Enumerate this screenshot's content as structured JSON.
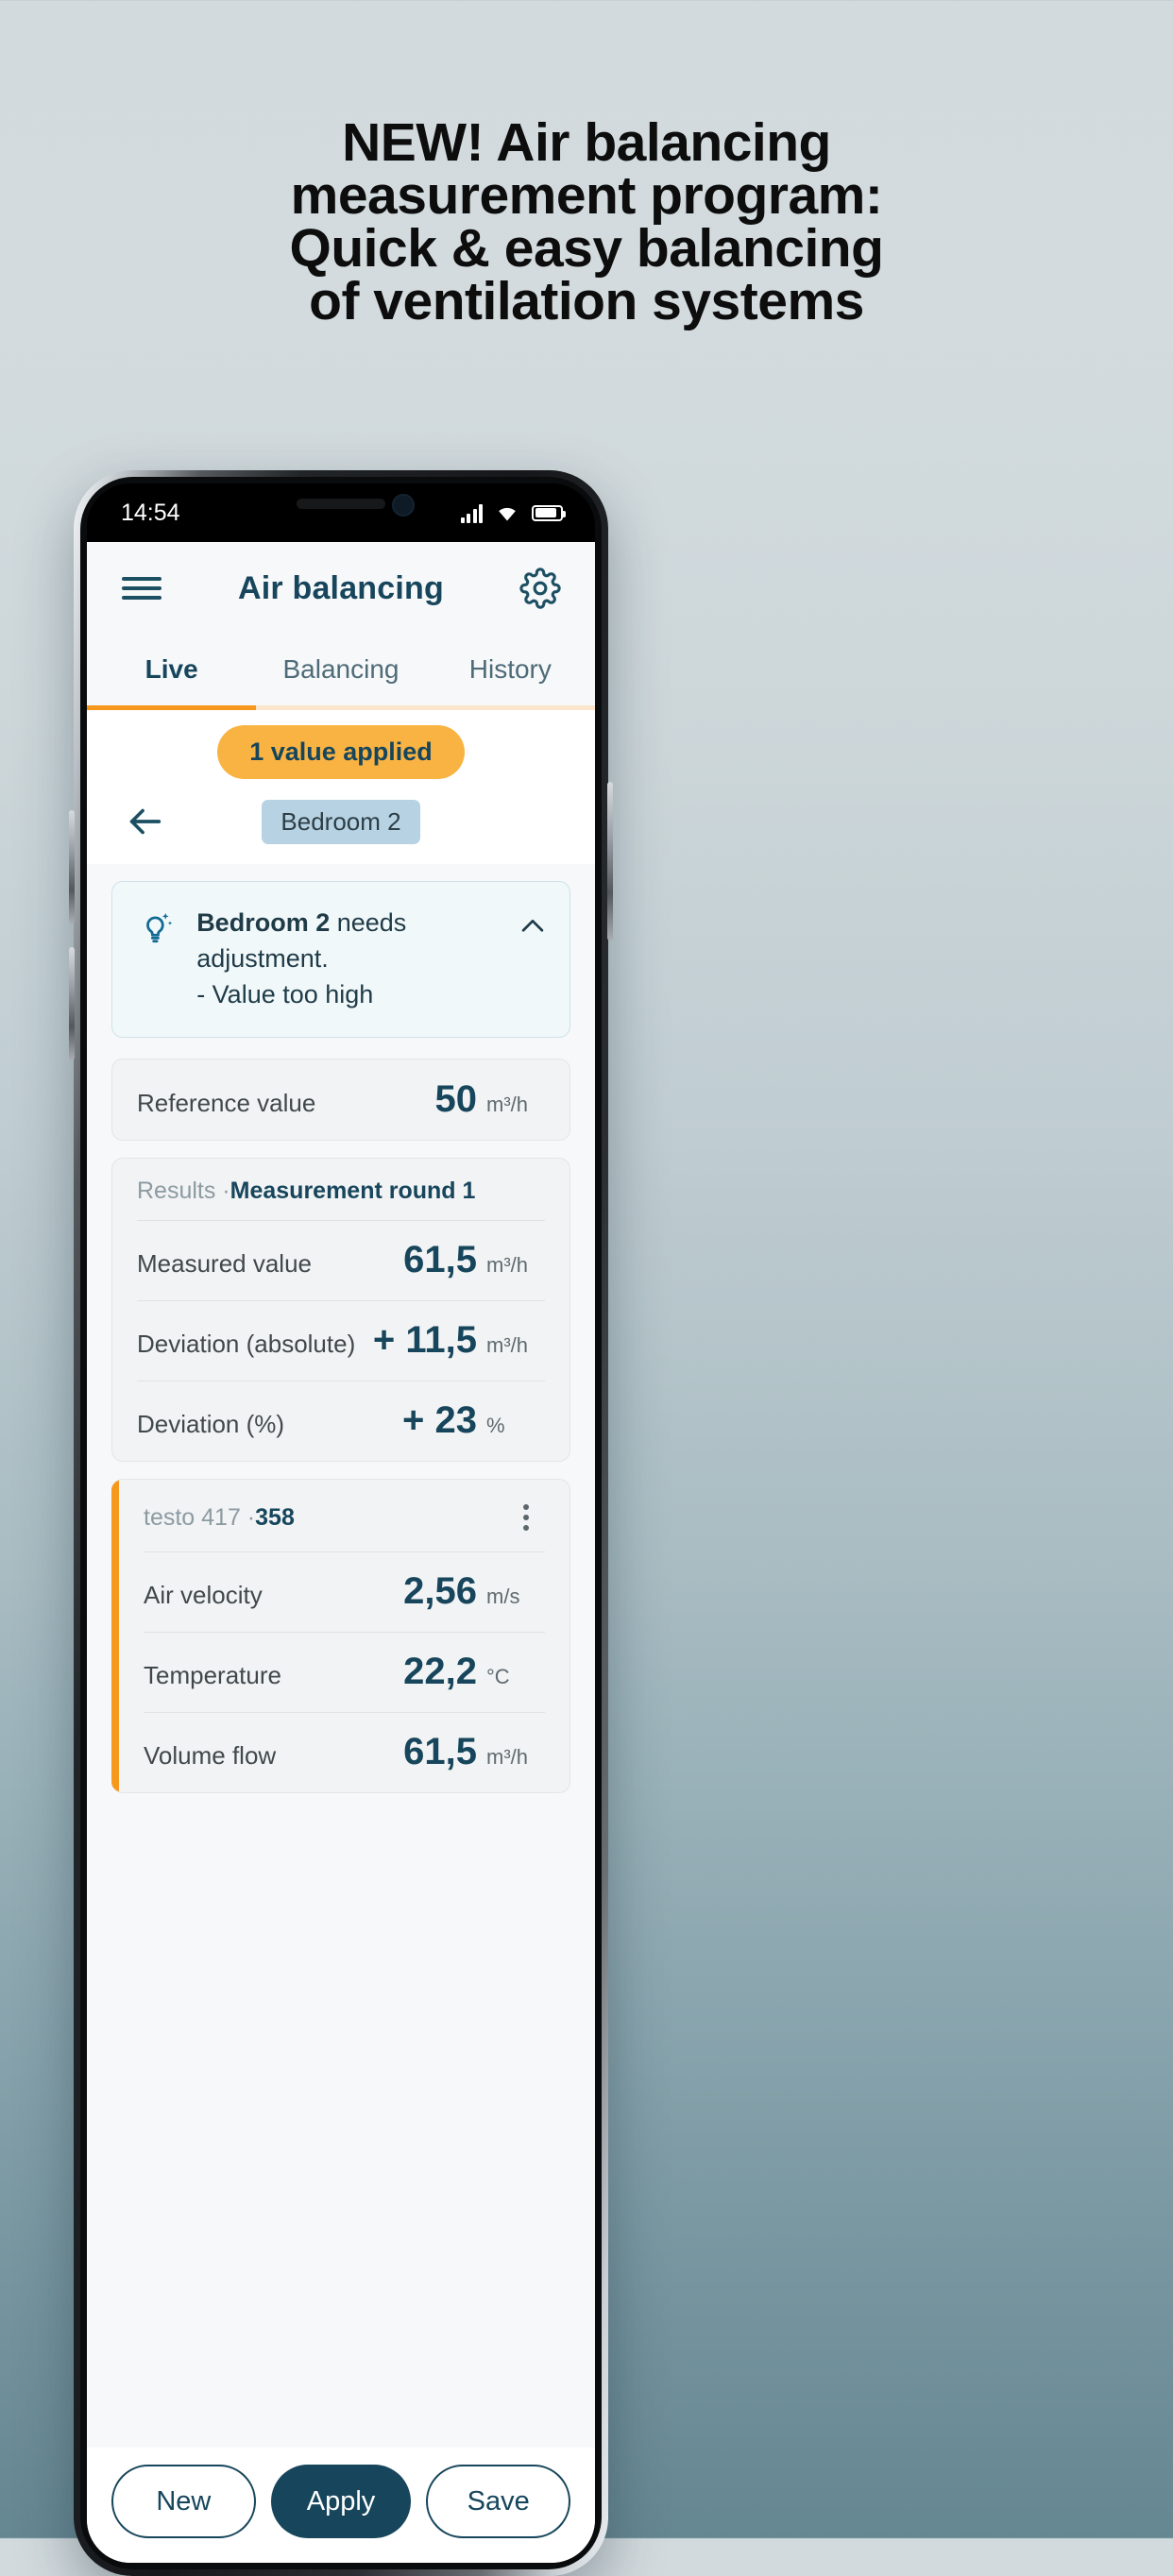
{
  "marketing": {
    "headline_lines": [
      "NEW! Air balancing",
      "measurement program:",
      "Quick & easy balancing",
      "of ventilation systems"
    ]
  },
  "colors": {
    "brand_dark": "#17465c",
    "accent_orange": "#f7981e",
    "badge_amber": "#f9b342",
    "chip_blue": "#b7d2e2",
    "hint_bg": "#f1f8fa"
  },
  "status_bar": {
    "time": "14:54",
    "icons": [
      "signal-icon",
      "wifi-icon",
      "battery-icon"
    ]
  },
  "app": {
    "title": "Air balancing",
    "menu_icon": "hamburger-menu-icon",
    "settings_icon": "gear-icon",
    "tabs": [
      {
        "label": "Live",
        "active": true
      },
      {
        "label": "Balancing",
        "active": false
      },
      {
        "label": "History",
        "active": false
      }
    ],
    "toast": {
      "label": "1 value applied"
    },
    "back_icon": "arrow-left-icon",
    "room_chip": {
      "label": "Bedroom 2"
    },
    "hint": {
      "icon": "lightbulb-idea-icon",
      "title_strong": "Bedroom 2",
      "title_rest": " needs adjustment.",
      "detail": "- Value too high",
      "collapse_icon": "chevron-up-icon"
    },
    "reference": {
      "label": "Reference value",
      "value": "50",
      "unit": "m³/h"
    },
    "results": {
      "head_muted": "Results · ",
      "head_strong": "Measurement round 1",
      "rows": [
        {
          "label": "Measured value",
          "value": "61,5",
          "unit": "m³/h"
        },
        {
          "label": "Deviation (absolute)",
          "value": "+ 11,5",
          "unit": "m³/h"
        },
        {
          "label": "Deviation (%)",
          "value": "+ 23",
          "unit": "%"
        }
      ]
    },
    "device": {
      "name_muted": "testo 417 · ",
      "name_strong": "358",
      "menu_icon": "kebab-menu-icon",
      "rows": [
        {
          "label": "Air velocity",
          "value": "2,56",
          "unit": "m/s"
        },
        {
          "label": "Temperature",
          "value": "22,2",
          "unit": "°C"
        },
        {
          "label": "Volume flow",
          "value": "61,5",
          "unit": "m³/h"
        }
      ]
    },
    "bottom_buttons": [
      {
        "label": "New",
        "style": "outline"
      },
      {
        "label": "Apply",
        "style": "filled"
      },
      {
        "label": "Save",
        "style": "outline"
      }
    ]
  }
}
